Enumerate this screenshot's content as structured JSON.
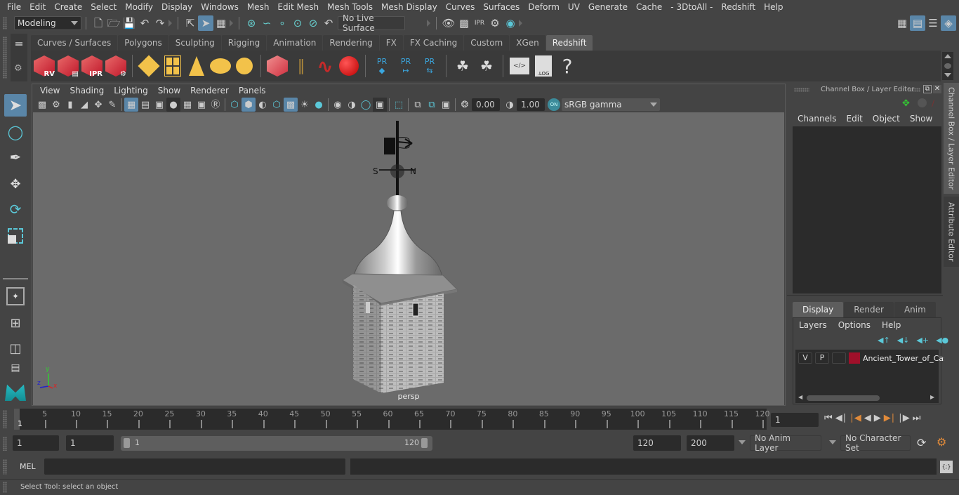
{
  "menubar": {
    "items": [
      "File",
      "Edit",
      "Create",
      "Select",
      "Modify",
      "Display",
      "Windows",
      "Mesh",
      "Edit Mesh",
      "Mesh Tools",
      "Mesh Display",
      "Curves",
      "Surfaces",
      "Deform",
      "UV",
      "Generate",
      "Cache",
      "- 3DtoAll -",
      "Redshift",
      "Help"
    ]
  },
  "statusline": {
    "workspace": "Modeling",
    "live_surface": "No Live Surface",
    "render_icons": [
      "render-view-icon",
      "render-current-frame-icon",
      "ipr-render-icon",
      "render-settings-icon",
      "hypershade-icon"
    ],
    "right_icons": [
      "modeling-toolkit-icon",
      "attribute-editor-toggle-icon",
      "tool-settings-icon",
      "channel-box-toggle-icon"
    ]
  },
  "shelf": {
    "tabs": [
      "Curves / Surfaces",
      "Polygons",
      "Sculpting",
      "Rigging",
      "Animation",
      "Rendering",
      "FX",
      "FX Caching",
      "Custom",
      "XGen",
      "Redshift"
    ],
    "active_tab": "Redshift",
    "rs_labels": {
      "rv": "RV",
      "ipr": "IPR",
      "pr": "PR",
      "log": ".LOG",
      "help": "?"
    }
  },
  "viewport": {
    "menu": [
      "View",
      "Shading",
      "Lighting",
      "Show",
      "Renderer",
      "Panels"
    ],
    "exposure": "0.00",
    "gamma": "1.00",
    "colorspace_toggle": "ON",
    "colorspace": "sRGB gamma",
    "camera_label": "persp",
    "axis": {
      "x": "x",
      "y": "y",
      "z": "z"
    }
  },
  "channel_box": {
    "title": "Channel Box / Layer Editor",
    "menu": [
      "Channels",
      "Edit",
      "Object",
      "Show"
    ]
  },
  "layer_editor": {
    "tabs": [
      "Display",
      "Render",
      "Anim"
    ],
    "active_tab": "Display",
    "menu": [
      "Layers",
      "Options",
      "Help"
    ],
    "layers": [
      {
        "v": "V",
        "p": "P",
        "name": "Ancient_Tower_of_Cas",
        "color": "#a0102a"
      }
    ]
  },
  "side_tabs": [
    "Channel Box / Layer Editor",
    "Attribute Editor"
  ],
  "timeline": {
    "ticks": [
      5,
      10,
      15,
      20,
      25,
      30,
      35,
      40,
      45,
      50,
      55,
      60,
      65,
      70,
      75,
      80,
      85,
      90,
      95,
      100,
      105,
      110,
      115,
      120
    ],
    "start_frame_marker": "1",
    "current_frame": "1",
    "min": 1,
    "max": 120
  },
  "range": {
    "start": "1",
    "current": "1",
    "slider_start": "1",
    "slider_end": "120",
    "end": "120",
    "anim_end": "200",
    "anim_layer": "No Anim Layer",
    "character_set": "No Character Set"
  },
  "command": {
    "language": "MEL",
    "input": "",
    "output": ""
  },
  "help_line": "Select Tool: select an object"
}
